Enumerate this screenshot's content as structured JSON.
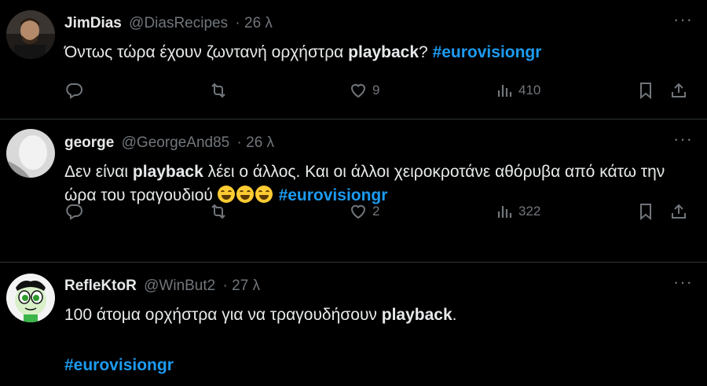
{
  "tweets": [
    {
      "name": "JimDias",
      "handle": "@DiasRecipes",
      "time": "· 26 λ",
      "text_before": "Όντως τώρα έχουν  ζωντανή ορχήστρα ",
      "bold": "playback",
      "text_after": "? ",
      "hashtag": "#eurovisiongr",
      "likes": "9",
      "views": "410"
    },
    {
      "name": "george",
      "handle": "@GeorgeAnd85",
      "time": "· 26 λ",
      "text_before": "Δεν είναι ",
      "bold": "playback",
      "text_after": " λέει ο άλλος. Και οι άλλοι χειροκροτάνε αθόρυβα από κάτω την ώρα του τραγουδιού ",
      "hashtag": "#eurovisiongr",
      "likes": "2",
      "views": "322"
    },
    {
      "name": "RefleKtoR",
      "handle": "@WinBut2",
      "time": "· 27 λ",
      "text_before": "100 άτομα ορχήστρα για να τραγουδήσουν ",
      "bold": "playback",
      "text_after": ".",
      "hashtag": "#eurovisiongr"
    }
  ],
  "more_label": "···",
  "colors": {
    "accent": "#1d9bf0",
    "muted": "#71767b",
    "text": "#e7e9ea"
  }
}
